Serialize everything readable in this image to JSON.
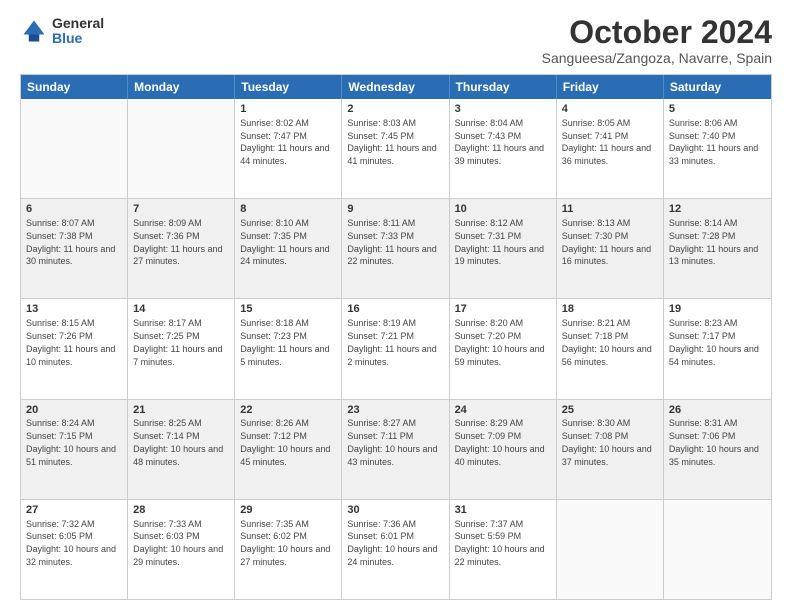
{
  "logo": {
    "general": "General",
    "blue": "Blue"
  },
  "title": {
    "month": "October 2024",
    "location": "Sangueesa/Zangoza, Navarre, Spain"
  },
  "weekdays": [
    "Sunday",
    "Monday",
    "Tuesday",
    "Wednesday",
    "Thursday",
    "Friday",
    "Saturday"
  ],
  "weeks": [
    [
      {
        "day": "",
        "info": ""
      },
      {
        "day": "",
        "info": ""
      },
      {
        "day": "1",
        "info": "Sunrise: 8:02 AM\nSunset: 7:47 PM\nDaylight: 11 hours and 44 minutes."
      },
      {
        "day": "2",
        "info": "Sunrise: 8:03 AM\nSunset: 7:45 PM\nDaylight: 11 hours and 41 minutes."
      },
      {
        "day": "3",
        "info": "Sunrise: 8:04 AM\nSunset: 7:43 PM\nDaylight: 11 hours and 39 minutes."
      },
      {
        "day": "4",
        "info": "Sunrise: 8:05 AM\nSunset: 7:41 PM\nDaylight: 11 hours and 36 minutes."
      },
      {
        "day": "5",
        "info": "Sunrise: 8:06 AM\nSunset: 7:40 PM\nDaylight: 11 hours and 33 minutes."
      }
    ],
    [
      {
        "day": "6",
        "info": "Sunrise: 8:07 AM\nSunset: 7:38 PM\nDaylight: 11 hours and 30 minutes."
      },
      {
        "day": "7",
        "info": "Sunrise: 8:09 AM\nSunset: 7:36 PM\nDaylight: 11 hours and 27 minutes."
      },
      {
        "day": "8",
        "info": "Sunrise: 8:10 AM\nSunset: 7:35 PM\nDaylight: 11 hours and 24 minutes."
      },
      {
        "day": "9",
        "info": "Sunrise: 8:11 AM\nSunset: 7:33 PM\nDaylight: 11 hours and 22 minutes."
      },
      {
        "day": "10",
        "info": "Sunrise: 8:12 AM\nSunset: 7:31 PM\nDaylight: 11 hours and 19 minutes."
      },
      {
        "day": "11",
        "info": "Sunrise: 8:13 AM\nSunset: 7:30 PM\nDaylight: 11 hours and 16 minutes."
      },
      {
        "day": "12",
        "info": "Sunrise: 8:14 AM\nSunset: 7:28 PM\nDaylight: 11 hours and 13 minutes."
      }
    ],
    [
      {
        "day": "13",
        "info": "Sunrise: 8:15 AM\nSunset: 7:26 PM\nDaylight: 11 hours and 10 minutes."
      },
      {
        "day": "14",
        "info": "Sunrise: 8:17 AM\nSunset: 7:25 PM\nDaylight: 11 hours and 7 minutes."
      },
      {
        "day": "15",
        "info": "Sunrise: 8:18 AM\nSunset: 7:23 PM\nDaylight: 11 hours and 5 minutes."
      },
      {
        "day": "16",
        "info": "Sunrise: 8:19 AM\nSunset: 7:21 PM\nDaylight: 11 hours and 2 minutes."
      },
      {
        "day": "17",
        "info": "Sunrise: 8:20 AM\nSunset: 7:20 PM\nDaylight: 10 hours and 59 minutes."
      },
      {
        "day": "18",
        "info": "Sunrise: 8:21 AM\nSunset: 7:18 PM\nDaylight: 10 hours and 56 minutes."
      },
      {
        "day": "19",
        "info": "Sunrise: 8:23 AM\nSunset: 7:17 PM\nDaylight: 10 hours and 54 minutes."
      }
    ],
    [
      {
        "day": "20",
        "info": "Sunrise: 8:24 AM\nSunset: 7:15 PM\nDaylight: 10 hours and 51 minutes."
      },
      {
        "day": "21",
        "info": "Sunrise: 8:25 AM\nSunset: 7:14 PM\nDaylight: 10 hours and 48 minutes."
      },
      {
        "day": "22",
        "info": "Sunrise: 8:26 AM\nSunset: 7:12 PM\nDaylight: 10 hours and 45 minutes."
      },
      {
        "day": "23",
        "info": "Sunrise: 8:27 AM\nSunset: 7:11 PM\nDaylight: 10 hours and 43 minutes."
      },
      {
        "day": "24",
        "info": "Sunrise: 8:29 AM\nSunset: 7:09 PM\nDaylight: 10 hours and 40 minutes."
      },
      {
        "day": "25",
        "info": "Sunrise: 8:30 AM\nSunset: 7:08 PM\nDaylight: 10 hours and 37 minutes."
      },
      {
        "day": "26",
        "info": "Sunrise: 8:31 AM\nSunset: 7:06 PM\nDaylight: 10 hours and 35 minutes."
      }
    ],
    [
      {
        "day": "27",
        "info": "Sunrise: 7:32 AM\nSunset: 6:05 PM\nDaylight: 10 hours and 32 minutes."
      },
      {
        "day": "28",
        "info": "Sunrise: 7:33 AM\nSunset: 6:03 PM\nDaylight: 10 hours and 29 minutes."
      },
      {
        "day": "29",
        "info": "Sunrise: 7:35 AM\nSunset: 6:02 PM\nDaylight: 10 hours and 27 minutes."
      },
      {
        "day": "30",
        "info": "Sunrise: 7:36 AM\nSunset: 6:01 PM\nDaylight: 10 hours and 24 minutes."
      },
      {
        "day": "31",
        "info": "Sunrise: 7:37 AM\nSunset: 5:59 PM\nDaylight: 10 hours and 22 minutes."
      },
      {
        "day": "",
        "info": ""
      },
      {
        "day": "",
        "info": ""
      }
    ]
  ]
}
